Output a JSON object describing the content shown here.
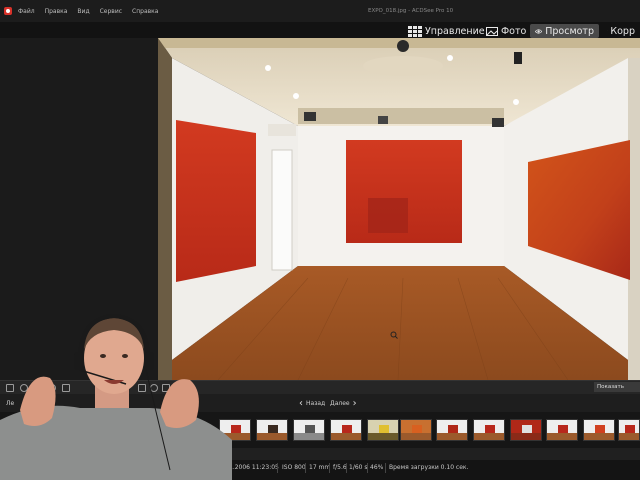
{
  "menubar": {
    "items": [
      "Файл",
      "Правка",
      "Вид",
      "Сервис",
      "Справка"
    ],
    "window_title": "EXPO_018.jpg - ACDSee Pro 10"
  },
  "modes": {
    "items": [
      {
        "label": "Управление",
        "icon": "grid-icon"
      },
      {
        "label": "Фото",
        "icon": "photo-icon"
      },
      {
        "label": "Просмотр",
        "icon": "eye-icon"
      },
      {
        "label": "Корр",
        "icon": "adjust-icon"
      }
    ],
    "active": "Просмотр"
  },
  "viewer": {
    "cursor_icon": "zoom-in-icon"
  },
  "toolbar": {
    "show_original_label": "Показать ориги"
  },
  "navigation": {
    "left_label": "Ле",
    "back_label": "Назад",
    "next_label": "Далее"
  },
  "info": {
    "datetime": "1.2006 11:23:05",
    "iso": "ISO 800",
    "focal": "17 mm",
    "aperture": "f/5.6",
    "shutter": "1/60 s",
    "zoom": "46%",
    "load_time": "Время загрузки 0.10 сек."
  },
  "colors": {
    "accent_active_tab": "#4a4a4a",
    "app_icon": "#d8322a",
    "background": "#1b1b1b"
  }
}
